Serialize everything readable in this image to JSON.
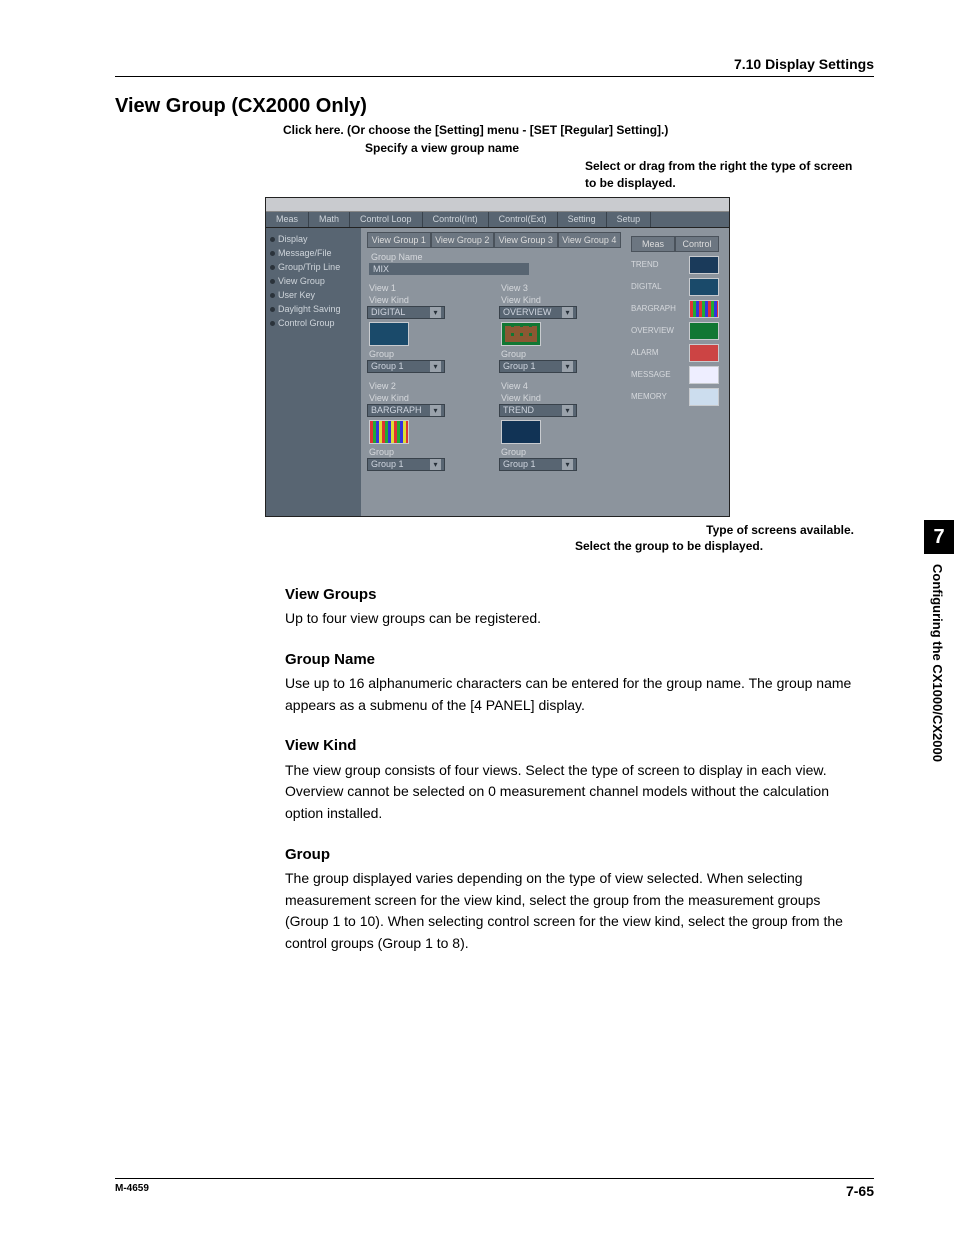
{
  "header": {
    "breadcrumb": "7.10  Display Settings"
  },
  "title": "View Group (CX2000 Only)",
  "callouts": {
    "c1": "Click here. (Or choose the [Setting] menu - [SET [Regular] Setting].)",
    "c2": "Specify a view group name",
    "c3": "Select or drag from the right the type of screen to be displayed.",
    "post_types": "Type of screens available.",
    "post_group": "Select the group to be displayed."
  },
  "app": {
    "top_tabs": [
      "Meas",
      "Math",
      "Control Loop",
      "Control(Int)",
      "Control(Ext)",
      "Setting",
      "Setup"
    ],
    "sidebar": [
      "Display",
      "Message/File",
      "Group/Trip Line",
      "View Group",
      "User Key",
      "Daylight Saving",
      "Control Group"
    ],
    "vg_tabs": [
      "View Group 1",
      "View Group 2",
      "View Group 3",
      "View Group 4"
    ],
    "group_name_label": "Group Name",
    "group_name_value": "MIX",
    "views": [
      {
        "title": "View 1",
        "kind_label": "View Kind",
        "kind": "DIGITAL",
        "thumb": "digital",
        "group_label": "Group",
        "group": "Group 1"
      },
      {
        "title": "View 2",
        "kind_label": "View Kind",
        "kind": "BARGRAPH",
        "thumb": "bargraph",
        "group_label": "Group",
        "group": "Group 1"
      },
      {
        "title": "View 3",
        "kind_label": "View Kind",
        "kind": "OVERVIEW",
        "thumb": "overview",
        "group_label": "Group",
        "group": "Group 1"
      },
      {
        "title": "View 4",
        "kind_label": "View Kind",
        "kind": "TREND",
        "thumb": "trend",
        "group_label": "Group",
        "group": "Group 1"
      }
    ],
    "palette_tabs": [
      "Meas",
      "Control"
    ],
    "palette": [
      {
        "label": "TREND",
        "cls": "pt-trend"
      },
      {
        "label": "DIGITAL",
        "cls": "pt-digital"
      },
      {
        "label": "BARGRAPH",
        "cls": "pt-bargraph"
      },
      {
        "label": "OVERVIEW",
        "cls": "pt-overview"
      },
      {
        "label": "ALARM",
        "cls": "pt-alarm"
      },
      {
        "label": "MESSAGE",
        "cls": "pt-message"
      },
      {
        "label": "MEMORY",
        "cls": "pt-memory"
      }
    ]
  },
  "sections": {
    "view_groups": {
      "h": "View Groups",
      "p": "Up to four view groups can be registered."
    },
    "group_name": {
      "h": "Group Name",
      "p": "Use up to 16 alphanumeric characters can be entered for the group name.  The group name appears as a submenu of the [4 PANEL] display."
    },
    "view_kind": {
      "h": "View Kind",
      "p": "The view group consists of four views.  Select the type of screen to display in each view.  Overview cannot be selected on 0 measurement channel models without the calculation option installed."
    },
    "group": {
      "h": "Group",
      "p": "The group displayed varies depending on the type of view selected. When selecting measurement screen for the view kind, select the group from the measurement groups (Group 1 to 10). When selecting control screen for the view kind, select the group from the control groups (Group 1 to 8)."
    }
  },
  "side_tab": {
    "num": "7",
    "text": "Configuring the CX1000/CX2000"
  },
  "footer": {
    "left": "M-4659",
    "right": "7-65"
  }
}
